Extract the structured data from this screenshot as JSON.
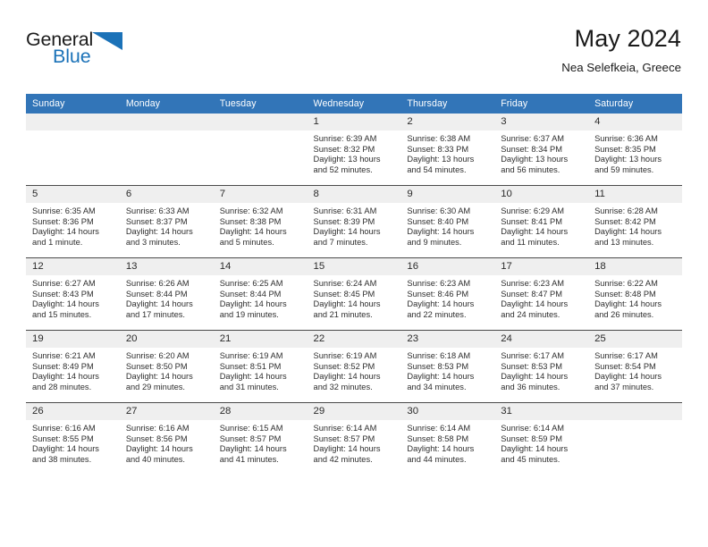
{
  "branding": {
    "logo_primary": "General",
    "logo_secondary": "Blue",
    "logo_icon": "triangle-icon",
    "accent_color": "#1b72b8"
  },
  "header": {
    "title": "May 2024",
    "subtitle": "Nea Selefkeia, Greece",
    "header_bg_color": "#3275b8",
    "daynum_bg_color": "#efefef"
  },
  "weekday_headers": [
    "Sunday",
    "Monday",
    "Tuesday",
    "Wednesday",
    "Thursday",
    "Friday",
    "Saturday"
  ],
  "labels": {
    "sunrise_prefix": "Sunrise:",
    "sunset_prefix": "Sunset:",
    "daylight_prefix": "Daylight:"
  },
  "weeks": [
    [
      {
        "day": "",
        "sunrise": "",
        "sunset": "",
        "daylight_line1": "",
        "daylight_line2": ""
      },
      {
        "day": "",
        "sunrise": "",
        "sunset": "",
        "daylight_line1": "",
        "daylight_line2": ""
      },
      {
        "day": "",
        "sunrise": "",
        "sunset": "",
        "daylight_line1": "",
        "daylight_line2": ""
      },
      {
        "day": "1",
        "sunrise": "Sunrise: 6:39 AM",
        "sunset": "Sunset: 8:32 PM",
        "daylight_line1": "Daylight: 13 hours",
        "daylight_line2": "and 52 minutes."
      },
      {
        "day": "2",
        "sunrise": "Sunrise: 6:38 AM",
        "sunset": "Sunset: 8:33 PM",
        "daylight_line1": "Daylight: 13 hours",
        "daylight_line2": "and 54 minutes."
      },
      {
        "day": "3",
        "sunrise": "Sunrise: 6:37 AM",
        "sunset": "Sunset: 8:34 PM",
        "daylight_line1": "Daylight: 13 hours",
        "daylight_line2": "and 56 minutes."
      },
      {
        "day": "4",
        "sunrise": "Sunrise: 6:36 AM",
        "sunset": "Sunset: 8:35 PM",
        "daylight_line1": "Daylight: 13 hours",
        "daylight_line2": "and 59 minutes."
      }
    ],
    [
      {
        "day": "5",
        "sunrise": "Sunrise: 6:35 AM",
        "sunset": "Sunset: 8:36 PM",
        "daylight_line1": "Daylight: 14 hours",
        "daylight_line2": "and 1 minute."
      },
      {
        "day": "6",
        "sunrise": "Sunrise: 6:33 AM",
        "sunset": "Sunset: 8:37 PM",
        "daylight_line1": "Daylight: 14 hours",
        "daylight_line2": "and 3 minutes."
      },
      {
        "day": "7",
        "sunrise": "Sunrise: 6:32 AM",
        "sunset": "Sunset: 8:38 PM",
        "daylight_line1": "Daylight: 14 hours",
        "daylight_line2": "and 5 minutes."
      },
      {
        "day": "8",
        "sunrise": "Sunrise: 6:31 AM",
        "sunset": "Sunset: 8:39 PM",
        "daylight_line1": "Daylight: 14 hours",
        "daylight_line2": "and 7 minutes."
      },
      {
        "day": "9",
        "sunrise": "Sunrise: 6:30 AM",
        "sunset": "Sunset: 8:40 PM",
        "daylight_line1": "Daylight: 14 hours",
        "daylight_line2": "and 9 minutes."
      },
      {
        "day": "10",
        "sunrise": "Sunrise: 6:29 AM",
        "sunset": "Sunset: 8:41 PM",
        "daylight_line1": "Daylight: 14 hours",
        "daylight_line2": "and 11 minutes."
      },
      {
        "day": "11",
        "sunrise": "Sunrise: 6:28 AM",
        "sunset": "Sunset: 8:42 PM",
        "daylight_line1": "Daylight: 14 hours",
        "daylight_line2": "and 13 minutes."
      }
    ],
    [
      {
        "day": "12",
        "sunrise": "Sunrise: 6:27 AM",
        "sunset": "Sunset: 8:43 PM",
        "daylight_line1": "Daylight: 14 hours",
        "daylight_line2": "and 15 minutes."
      },
      {
        "day": "13",
        "sunrise": "Sunrise: 6:26 AM",
        "sunset": "Sunset: 8:44 PM",
        "daylight_line1": "Daylight: 14 hours",
        "daylight_line2": "and 17 minutes."
      },
      {
        "day": "14",
        "sunrise": "Sunrise: 6:25 AM",
        "sunset": "Sunset: 8:44 PM",
        "daylight_line1": "Daylight: 14 hours",
        "daylight_line2": "and 19 minutes."
      },
      {
        "day": "15",
        "sunrise": "Sunrise: 6:24 AM",
        "sunset": "Sunset: 8:45 PM",
        "daylight_line1": "Daylight: 14 hours",
        "daylight_line2": "and 21 minutes."
      },
      {
        "day": "16",
        "sunrise": "Sunrise: 6:23 AM",
        "sunset": "Sunset: 8:46 PM",
        "daylight_line1": "Daylight: 14 hours",
        "daylight_line2": "and 22 minutes."
      },
      {
        "day": "17",
        "sunrise": "Sunrise: 6:23 AM",
        "sunset": "Sunset: 8:47 PM",
        "daylight_line1": "Daylight: 14 hours",
        "daylight_line2": "and 24 minutes."
      },
      {
        "day": "18",
        "sunrise": "Sunrise: 6:22 AM",
        "sunset": "Sunset: 8:48 PM",
        "daylight_line1": "Daylight: 14 hours",
        "daylight_line2": "and 26 minutes."
      }
    ],
    [
      {
        "day": "19",
        "sunrise": "Sunrise: 6:21 AM",
        "sunset": "Sunset: 8:49 PM",
        "daylight_line1": "Daylight: 14 hours",
        "daylight_line2": "and 28 minutes."
      },
      {
        "day": "20",
        "sunrise": "Sunrise: 6:20 AM",
        "sunset": "Sunset: 8:50 PM",
        "daylight_line1": "Daylight: 14 hours",
        "daylight_line2": "and 29 minutes."
      },
      {
        "day": "21",
        "sunrise": "Sunrise: 6:19 AM",
        "sunset": "Sunset: 8:51 PM",
        "daylight_line1": "Daylight: 14 hours",
        "daylight_line2": "and 31 minutes."
      },
      {
        "day": "22",
        "sunrise": "Sunrise: 6:19 AM",
        "sunset": "Sunset: 8:52 PM",
        "daylight_line1": "Daylight: 14 hours",
        "daylight_line2": "and 32 minutes."
      },
      {
        "day": "23",
        "sunrise": "Sunrise: 6:18 AM",
        "sunset": "Sunset: 8:53 PM",
        "daylight_line1": "Daylight: 14 hours",
        "daylight_line2": "and 34 minutes."
      },
      {
        "day": "24",
        "sunrise": "Sunrise: 6:17 AM",
        "sunset": "Sunset: 8:53 PM",
        "daylight_line1": "Daylight: 14 hours",
        "daylight_line2": "and 36 minutes."
      },
      {
        "day": "25",
        "sunrise": "Sunrise: 6:17 AM",
        "sunset": "Sunset: 8:54 PM",
        "daylight_line1": "Daylight: 14 hours",
        "daylight_line2": "and 37 minutes."
      }
    ],
    [
      {
        "day": "26",
        "sunrise": "Sunrise: 6:16 AM",
        "sunset": "Sunset: 8:55 PM",
        "daylight_line1": "Daylight: 14 hours",
        "daylight_line2": "and 38 minutes."
      },
      {
        "day": "27",
        "sunrise": "Sunrise: 6:16 AM",
        "sunset": "Sunset: 8:56 PM",
        "daylight_line1": "Daylight: 14 hours",
        "daylight_line2": "and 40 minutes."
      },
      {
        "day": "28",
        "sunrise": "Sunrise: 6:15 AM",
        "sunset": "Sunset: 8:57 PM",
        "daylight_line1": "Daylight: 14 hours",
        "daylight_line2": "and 41 minutes."
      },
      {
        "day": "29",
        "sunrise": "Sunrise: 6:14 AM",
        "sunset": "Sunset: 8:57 PM",
        "daylight_line1": "Daylight: 14 hours",
        "daylight_line2": "and 42 minutes."
      },
      {
        "day": "30",
        "sunrise": "Sunrise: 6:14 AM",
        "sunset": "Sunset: 8:58 PM",
        "daylight_line1": "Daylight: 14 hours",
        "daylight_line2": "and 44 minutes."
      },
      {
        "day": "31",
        "sunrise": "Sunrise: 6:14 AM",
        "sunset": "Sunset: 8:59 PM",
        "daylight_line1": "Daylight: 14 hours",
        "daylight_line2": "and 45 minutes."
      },
      {
        "day": "",
        "sunrise": "",
        "sunset": "",
        "daylight_line1": "",
        "daylight_line2": ""
      }
    ]
  ]
}
